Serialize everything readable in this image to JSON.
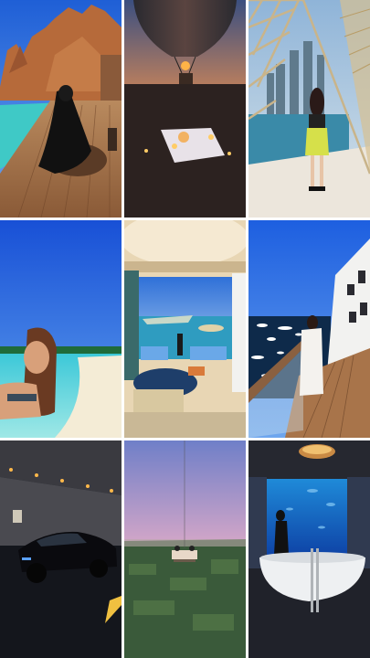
{
  "collage": {
    "tiles": [
      {
        "name": "desert-pool-deck-photo"
      },
      {
        "name": "hot-air-balloon-dinner-photo"
      },
      {
        "name": "glass-skyscraper-window-photo"
      },
      {
        "name": "tropical-beach-photo"
      },
      {
        "name": "palm-island-suite-photo"
      },
      {
        "name": "ship-deck-icebergs-photo"
      },
      {
        "name": "tunnel-black-car-photo"
      },
      {
        "name": "suspended-dining-sky-photo"
      },
      {
        "name": "underwater-suite-bathtub-photo"
      }
    ]
  }
}
